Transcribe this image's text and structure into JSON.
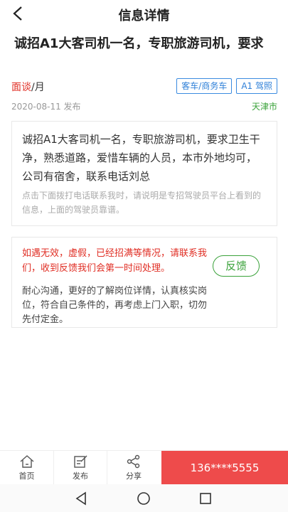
{
  "header": {
    "title": "信息详情"
  },
  "post": {
    "title": "诚招A1大客司机一名，专职旅游司机，要求",
    "salary_value": "面谈",
    "salary_unit": "/月",
    "tags": [
      "客车/商务车",
      "A1 驾照"
    ],
    "date": "2020-08-11 发布",
    "city": "天津市"
  },
  "description": {
    "text": "诚招A1大客司机一名，专职旅游司机，要求卫生干净，熟悉道路，爱惜车辆的人员，本市外地均可，公司有宿舍，联系电话刘总",
    "note": "点击下面拨打电话联系我时，请说明是专招驾驶员平台上看到的信息，上面的驾驶员靠谱。"
  },
  "warning": {
    "text": "如遇无效，虚假，已经招满等情况，请联系我们，收到反馈我们会第一时间处理。",
    "feedback_label": "反馈",
    "tip": "耐心沟通，更好的了解岗位详情，认真核实岗位，符合自己条件的，再考虑上门入职，切勿先付定金。"
  },
  "bottom_bar": {
    "home_label": "首页",
    "post_label": "发布",
    "share_label": "分享",
    "phone": "136****5555"
  },
  "colors": {
    "accent_red": "#e02e24",
    "accent_green": "#3aa23a",
    "tag_blue": "#2f80d8",
    "call_bg": "#ee4b4b"
  },
  "icons": {
    "back": "chevron-left-icon",
    "home": "home-icon",
    "post": "edit-icon",
    "share": "share-icon"
  }
}
